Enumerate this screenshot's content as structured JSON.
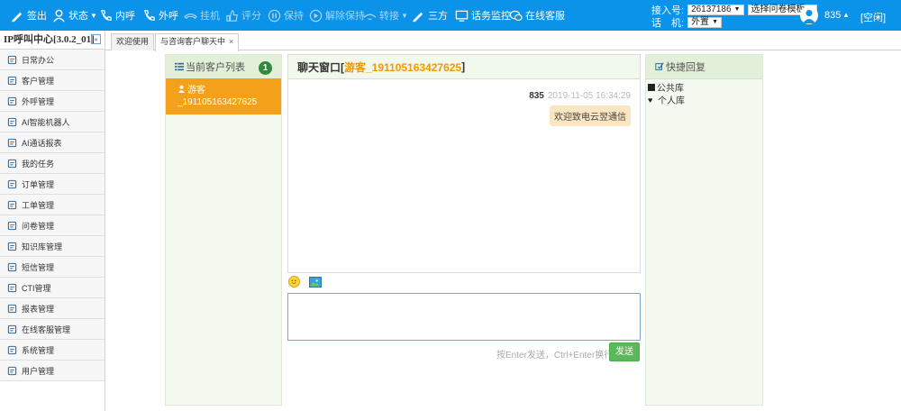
{
  "toolbar": {
    "items": [
      {
        "label": "签出",
        "icon": "sign-out-icon",
        "enabled": true
      },
      {
        "label": "状态",
        "icon": "status-icon",
        "enabled": true
      },
      {
        "label": "内呼",
        "icon": "internal-call-icon",
        "enabled": true
      },
      {
        "label": "外呼",
        "icon": "outbound-call-icon",
        "enabled": true
      },
      {
        "label": "挂机",
        "icon": "hangup-icon",
        "enabled": false
      },
      {
        "label": "评分",
        "icon": "rating-icon",
        "enabled": false
      },
      {
        "label": "保持",
        "icon": "hold-icon",
        "enabled": false
      },
      {
        "label": "解除保持",
        "icon": "unhold-icon",
        "enabled": false
      },
      {
        "label": "转接",
        "icon": "transfer-icon",
        "enabled": false
      },
      {
        "label": "三方",
        "icon": "conference-icon",
        "enabled": true
      },
      {
        "label": "话务监控",
        "icon": "monitor-icon",
        "enabled": true
      },
      {
        "label": "在线客服",
        "icon": "online-service-icon",
        "enabled": true
      }
    ],
    "trunk_label": "接入号:",
    "trunk_value": "26137186",
    "survey_value": "选择问卷模板",
    "phone_label": "话　机:",
    "phone_value": "外置",
    "user_name": "835",
    "status": "[空闲]",
    "accent": "#0a93e8"
  },
  "sidebar": {
    "title": "IP呼叫中心[3.0.2_01]",
    "collapse_label": "«",
    "items": [
      {
        "label": "日常办公",
        "icon": "daily-office-icon"
      },
      {
        "label": "客户管理",
        "icon": "customer-icon"
      },
      {
        "label": "外呼管理",
        "icon": "headset-icon"
      },
      {
        "label": "AI智能机器人",
        "icon": "robot-icon"
      },
      {
        "label": "AI通话报表",
        "icon": "ai-report-icon"
      },
      {
        "label": "我的任务",
        "icon": "task-icon"
      },
      {
        "label": "订单管理",
        "icon": "order-icon"
      },
      {
        "label": "工单管理",
        "icon": "ticket-icon"
      },
      {
        "label": "问卷管理",
        "icon": "survey-icon"
      },
      {
        "label": "知识库管理",
        "icon": "knowledge-icon"
      },
      {
        "label": "短信管理",
        "icon": "sms-icon"
      },
      {
        "label": "CTI管理",
        "icon": "cti-icon"
      },
      {
        "label": "报表管理",
        "icon": "report-icon"
      },
      {
        "label": "在线客服管理",
        "icon": "chat-icon"
      },
      {
        "label": "系统管理",
        "icon": "settings-icon"
      },
      {
        "label": "用户管理",
        "icon": "user-icon"
      }
    ]
  },
  "tabs": [
    {
      "label": "欢迎使用"
    },
    {
      "label": "与咨询客户聊天中",
      "close": "×"
    }
  ],
  "customers": {
    "title": "当前客户列表",
    "count": "1",
    "active": {
      "line1": "游客",
      "line2": "_191105163427625"
    }
  },
  "chat": {
    "title_prefix": "聊天窗口[",
    "visitor": "游客_191105163427625",
    "title_suffix": "]",
    "message": {
      "sender": "835",
      "time": "2019-11-05 16:34:29",
      "text": "欢迎致电云翌通信"
    },
    "hint": "按Enter发送，Ctrl+Enter换行",
    "send_label": "发送"
  },
  "quick_reply": {
    "title": "快捷回复",
    "items": [
      {
        "label": "公共库",
        "icon": "library-icon"
      },
      {
        "label": "个人库",
        "icon": "heart-icon"
      }
    ]
  }
}
